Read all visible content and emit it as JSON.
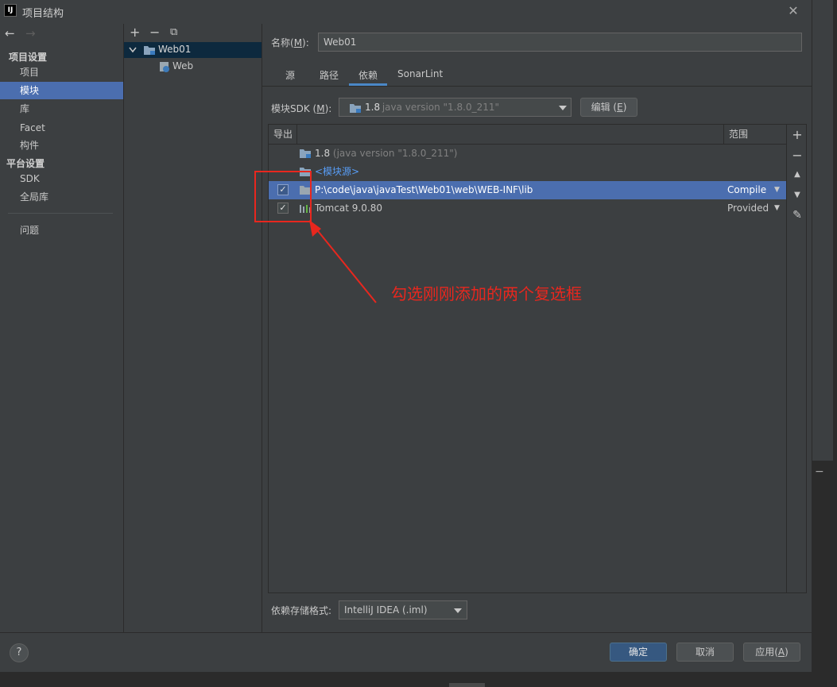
{
  "window": {
    "app_icon": "IJ",
    "title": "项目结构",
    "close_glyph": "✕"
  },
  "nav": {
    "back_glyph": "←",
    "forward_glyph": "→",
    "project_settings_heading": "项目设置",
    "project_settings_items": [
      "项目",
      "模块",
      "库",
      "Facet",
      "构件"
    ],
    "selected": "模块",
    "platform_settings_heading": "平台设置",
    "platform_settings_items": [
      "SDK",
      "全局库"
    ],
    "problems": "问题"
  },
  "tree": {
    "add_glyph": "+",
    "remove_glyph": "−",
    "copy_glyph": "⧉",
    "module": "Web01",
    "facet": "Web"
  },
  "module": {
    "name_label": "名称(M):",
    "name_value": "Web01",
    "tabs": [
      "源",
      "路径",
      "依赖",
      "SonarLint"
    ],
    "active_tab": "依赖",
    "sdk_label": "模块SDK (M):",
    "sdk_value_bold": "1.8",
    "sdk_value_rest": " java version \"1.8.0_211\"",
    "edit_button": "编辑 (E)"
  },
  "dependencies": {
    "col_export": "导出",
    "col_scope": "范围",
    "rows": [
      {
        "name": "1.8",
        "detail": " (java version \"1.8.0_211\")",
        "scope": "",
        "checkbox": false
      },
      {
        "name": "<模块源>",
        "detail": "",
        "scope": "",
        "checkbox": false
      },
      {
        "name": "P:\\code\\java\\javaTest\\Web01\\web\\WEB-INF\\lib",
        "detail": "",
        "scope": "Compile",
        "checkbox": true,
        "checked": true,
        "selected": true
      },
      {
        "name": "Tomcat 9.0.80",
        "detail": "",
        "scope": "Provided",
        "checkbox": true,
        "checked": true
      }
    ],
    "toolbar": {
      "add": "+",
      "remove": "−",
      "up": "▲",
      "down": "▼",
      "edit": "✎"
    }
  },
  "storage": {
    "label": "依赖存储格式:",
    "value": "IntelliJ IDEA (.iml)"
  },
  "footer": {
    "help": "?",
    "ok": "确定",
    "cancel": "取消",
    "apply": "应用(A)"
  },
  "annotation": {
    "text": "勾选刚刚添加的两个复选框",
    "color": "#e8271e"
  },
  "colors": {
    "background": "#3c3f41",
    "selection": "#4b6eaf",
    "tab_underline": "#4a88c7",
    "module_source": "#589df6"
  },
  "outer": {
    "minus_glyph": "−"
  }
}
